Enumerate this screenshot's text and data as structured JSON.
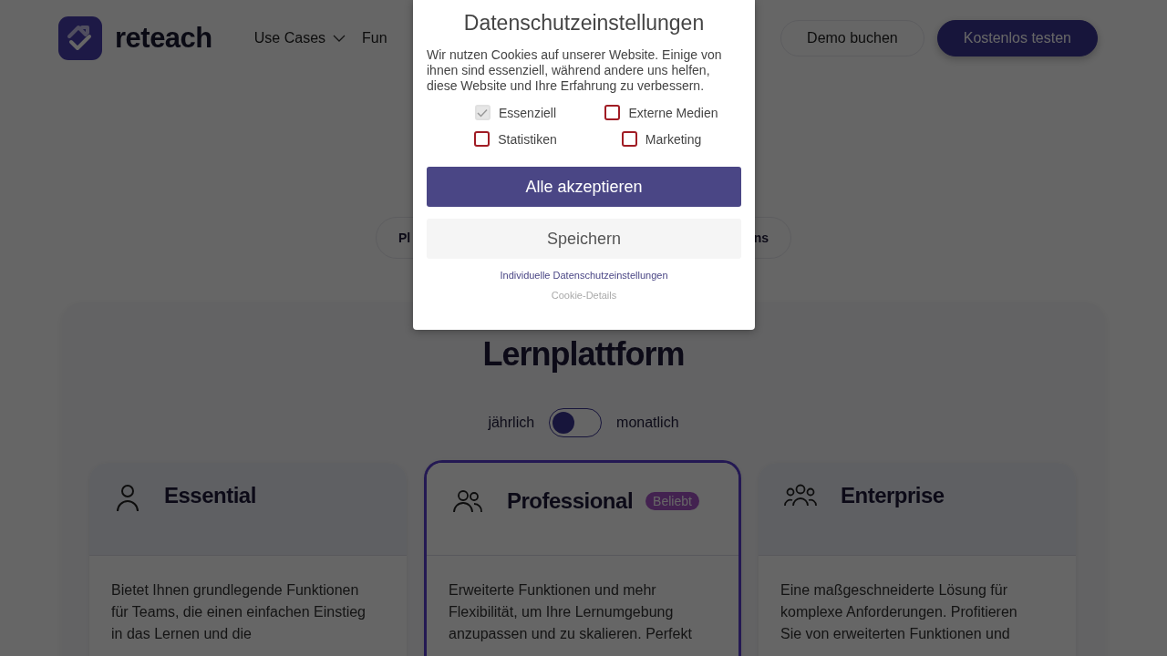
{
  "header": {
    "logo_text": "reteach",
    "nav": [
      {
        "label": "Use Cases",
        "dropdown": true
      },
      {
        "label": "Fun",
        "dropdown": false
      }
    ],
    "buttons": [
      {
        "label": "Demo buchen",
        "kind": "secondary"
      },
      {
        "label": "Kostenlos testen",
        "kind": "primary"
      }
    ]
  },
  "tabs_pill": {
    "left_text": "Pl",
    "right_text": "ns"
  },
  "pricing": {
    "title": "Lernplattform",
    "toggle": {
      "left": "jährlich",
      "right": "monatlich",
      "on": false
    },
    "plans": [
      {
        "name": "Essential",
        "highlighted": false,
        "description": "Bietet Ihnen grundlegende Funktionen für Teams, die einen einfachen Einstieg in das Lernen und die"
      },
      {
        "name": "Professional",
        "badge": "Beliebt",
        "highlighted": true,
        "description": "Erweiterte Funktionen und mehr Flexibilität, um Ihre Lernumgebung anzupassen und zu skalieren. Perfekt"
      },
      {
        "name": "Enterprise",
        "highlighted": false,
        "description": "Eine maßgeschneiderte Lösung für komplexe Anforderungen. Profitieren Sie von erweiterten Funktionen und"
      }
    ]
  },
  "cookie_dialog": {
    "title": "Datenschutzeinstellungen",
    "text": "Wir nutzen Cookies auf unserer Website. Einige von ihnen sind essenziell, während andere uns helfen, diese Website und Ihre Erfahrung zu verbessern.",
    "options": [
      {
        "label": "Essenziell",
        "checked": true,
        "disabled": true
      },
      {
        "label": "Externe Medien",
        "checked": false,
        "disabled": false
      },
      {
        "label": "Statistiken",
        "checked": false,
        "disabled": false
      },
      {
        "label": "Marketing",
        "checked": false,
        "disabled": false
      }
    ],
    "accept_button": "Alle akzeptieren",
    "save_button": "Speichern",
    "individual_link": "Individuelle Datenschutzeinstellungen",
    "details_link": "Cookie-Details"
  }
}
